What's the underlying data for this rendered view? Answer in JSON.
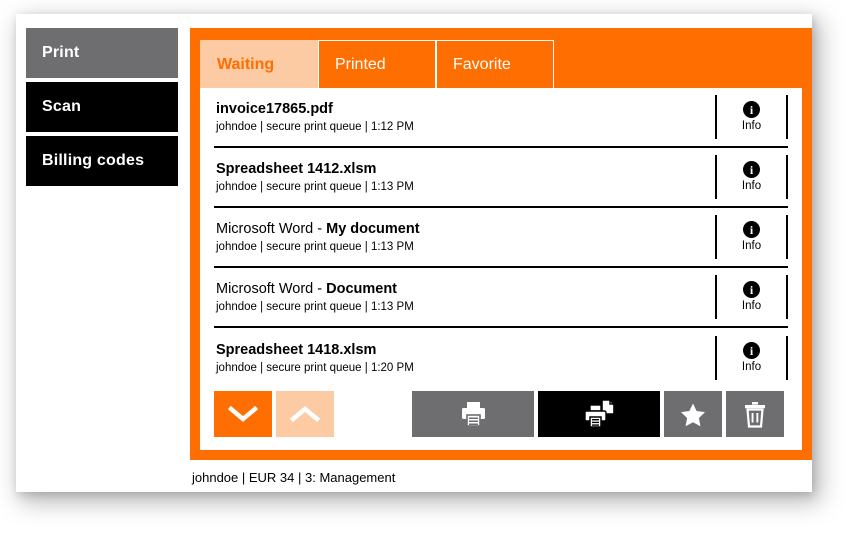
{
  "colors": {
    "orange": "#ff6e00",
    "orange_light": "#fdcba3",
    "gray": "#6e6e70",
    "black": "#000000",
    "white": "#ffffff"
  },
  "sidebar": {
    "items": [
      {
        "label": "Print",
        "state": "active",
        "icon": "print-icon"
      },
      {
        "label": "Scan",
        "state": "normal",
        "icon": "scan-icon"
      },
      {
        "label": "Billing codes",
        "state": "normal",
        "icon": "billing-icon"
      }
    ]
  },
  "tabs": [
    {
      "label": "Waiting",
      "active": true
    },
    {
      "label": "Printed",
      "active": false
    },
    {
      "label": "Favorite",
      "active": false
    }
  ],
  "jobs": [
    {
      "title": "invoice17865.pdf",
      "title_prefix": "",
      "owner": "johndoe",
      "queue": "secure print queue",
      "time": "1:12 PM",
      "meta": "johndoe | secure print queue | 1:12 PM",
      "info_label": "Info",
      "info_icon": "info-icon"
    },
    {
      "title": "Spreadsheet 1412.xlsm",
      "title_prefix": "",
      "owner": "johndoe",
      "queue": "secure print queue",
      "time": "1:13 PM",
      "meta": "johndoe | secure print queue | 1:13 PM",
      "info_label": "Info",
      "info_icon": "info-icon"
    },
    {
      "title": "My document",
      "title_prefix": "Microsoft Word - ",
      "owner": "johndoe",
      "queue": "secure print queue",
      "time": "1:13 PM",
      "meta": "johndoe | secure print queue | 1:13 PM",
      "info_label": "Info",
      "info_icon": "info-icon"
    },
    {
      "title": "Document",
      "title_prefix": "Microsoft Word - ",
      "owner": "johndoe",
      "queue": "secure print queue",
      "time": "1:13 PM",
      "meta": "johndoe | secure print queue | 1:13 PM",
      "info_label": "Info",
      "info_icon": "info-icon"
    },
    {
      "title": "Spreadsheet 1418.xlsm",
      "title_prefix": "",
      "owner": "johndoe",
      "queue": "secure print queue",
      "time": "1:20 PM",
      "meta": "johndoe | secure print queue | 1:20 PM",
      "info_label": "Info",
      "info_icon": "info-icon"
    }
  ],
  "toolbar": {
    "scroll_down": {
      "icon": "chevron-down-icon",
      "enabled": true
    },
    "scroll_up": {
      "icon": "chevron-up-icon",
      "enabled": false
    },
    "print": {
      "icon": "printer-icon",
      "style": "gray"
    },
    "print_and_keep": {
      "icon": "printer-copy-icon",
      "style": "black"
    },
    "favorite": {
      "icon": "star-icon",
      "style": "gray"
    },
    "delete": {
      "icon": "trash-icon",
      "style": "gray"
    }
  },
  "statusbar": {
    "user": "johndoe",
    "balance": "EUR 34",
    "department": "3: Management",
    "text": "johndoe | EUR 34 | 3: Management"
  }
}
